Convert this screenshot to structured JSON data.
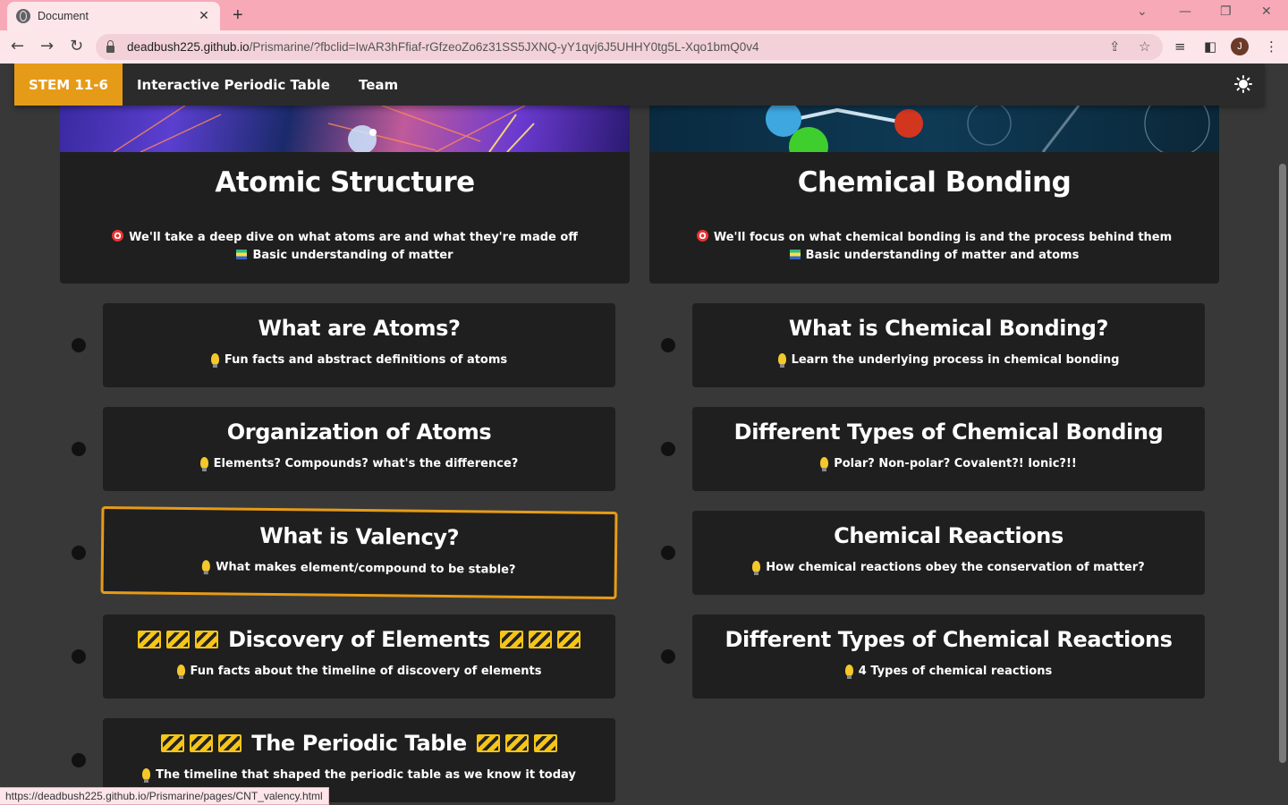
{
  "browser": {
    "tab_title": "Document",
    "tab_close": "✕",
    "new_tab": "+",
    "url_host": "deadbush225.github.io",
    "url_path": "/Prismarine/?fbclid=IwAR3hFfiaf-rGfzeoZo6z31SS5JXNQ-yY1qvj6J5UHHY0tg5L-Xqo1bmQ0v4",
    "profile_initial": "J",
    "status_url": "https://deadbush225.github.io/Prismarine/pages/CNT_valency.html"
  },
  "nav": {
    "brand": "STEM 11-6",
    "links": [
      "Interactive Periodic Table",
      "Team"
    ]
  },
  "topics": [
    {
      "title": "Atomic Structure",
      "goal": "We'll take a deep dive on what atoms are and what they're made off",
      "prereq": "Basic understanding of matter"
    },
    {
      "title": "Chemical Bonding",
      "goal": "We'll focus on what chemical bonding is and the process behind them",
      "prereq": "Basic understanding of matter and atoms"
    }
  ],
  "left_cards": [
    {
      "title": "What are Atoms?",
      "sub": "Fun facts and abstract definitions of atoms"
    },
    {
      "title": "Organization of Atoms",
      "sub": "Elements? Compounds? what's the difference?"
    },
    {
      "title": "What is Valency?",
      "sub": "What makes element/compound to be stable?"
    },
    {
      "title": "Discovery of Elements",
      "sub": "Fun facts about the timeline of discovery of elements"
    },
    {
      "title": "The Periodic Table",
      "sub": "The timeline that shaped the periodic table as we know it today"
    }
  ],
  "right_cards": [
    {
      "title": "What is Chemical Bonding?",
      "sub": "Learn the underlying process in chemical bonding"
    },
    {
      "title": "Different Types of Chemical Bonding",
      "sub": "Polar? Non-polar? Covalent?! Ionic?!!"
    },
    {
      "title": "Chemical Reactions",
      "sub": "How chemical reactions obey the conservation of matter?"
    },
    {
      "title": "Different Types of Chemical Reactions",
      "sub": "4 Types of chemical reactions"
    }
  ],
  "colors": {
    "accent": "#e69b18",
    "card": "#1f1f1f",
    "page": "#383838",
    "tabbar": "#f7a9b8"
  }
}
